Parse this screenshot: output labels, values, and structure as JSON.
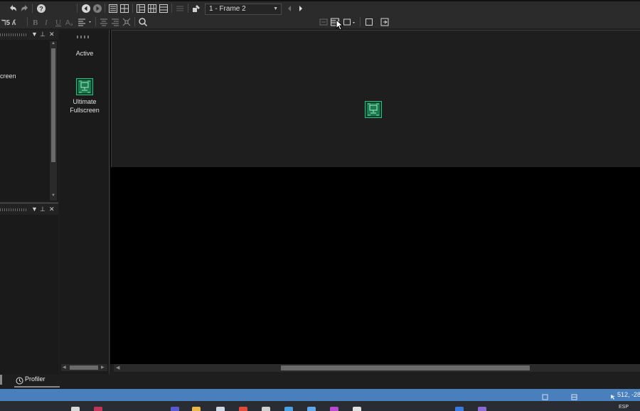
{
  "toolbar": {
    "frame_select_value": "1 - Frame 2",
    "tools_row1": [
      "undo-icon",
      "redo-icon",
      "help-icon",
      "back-icon",
      "forward-icon",
      "list-view-icon",
      "grid-view-icon",
      "layout-a-icon",
      "layout-b-icon",
      "layout-c-icon",
      "text-disabled-icon",
      "paint-icon",
      "prev-frame-icon",
      "next-frame-icon"
    ],
    "tools_row2": [
      "bold-icon",
      "italic-icon",
      "underline-icon",
      "align-left-icon",
      "align-center-icon",
      "align-right-icon",
      "zoom-icon",
      "snap-icon",
      "grid-toggle-icon",
      "rect-icon",
      "box-icon",
      "export-icon"
    ]
  },
  "left_panel": {
    "partial_label": "creen"
  },
  "object_panel": {
    "items": [
      {
        "label": "Active"
      },
      {
        "label_line1": "Ultimate",
        "label_line2": "Fullscreen"
      }
    ]
  },
  "bottom_tab": {
    "profiler_label": "Profiler"
  },
  "status_bar": {
    "coords": "512, -28"
  },
  "taskbar": {
    "language": "ESP"
  },
  "colors": {
    "status_bar": "#4a7fbd",
    "canvas_frame": "#1e1e1e",
    "canvas_outside": "#000000",
    "icon_green": "#1d7a4f"
  }
}
